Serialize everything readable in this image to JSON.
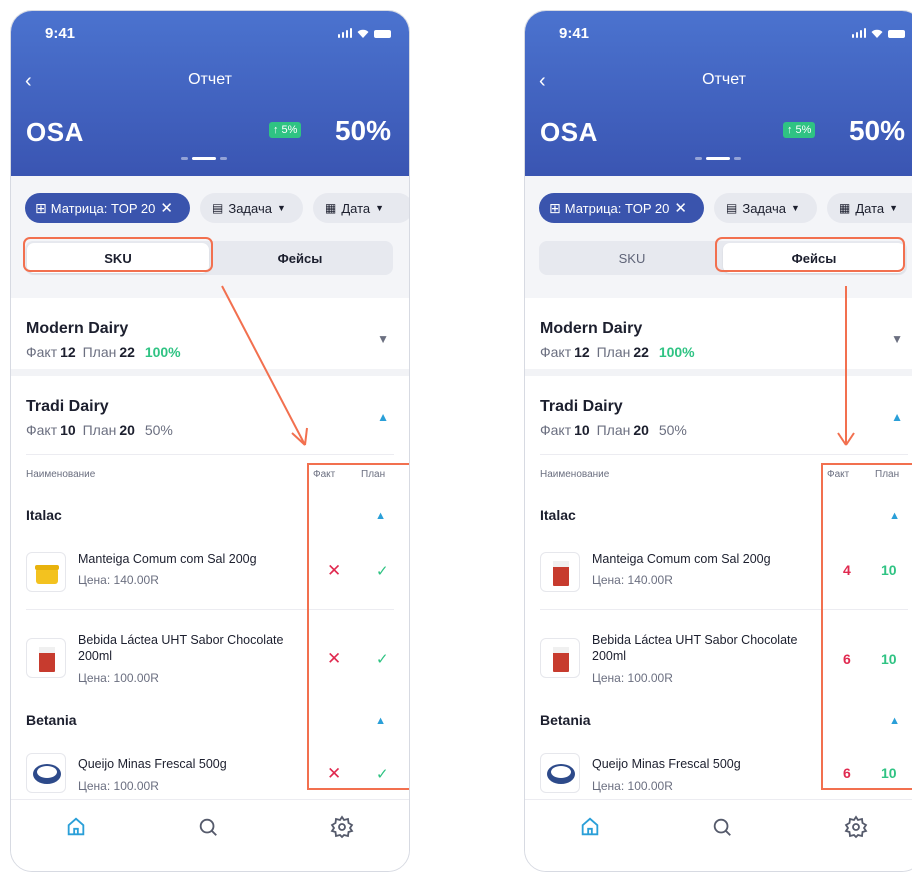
{
  "screens": [
    {
      "status": {
        "time": "9:41"
      },
      "header": {
        "title": "Отчет",
        "metric_name": "OSA",
        "delta": "↑ 5%",
        "value": "50%"
      },
      "filters": {
        "matrix": "Матрица: TOP 20",
        "task": "Задача",
        "date": "Дата"
      },
      "segments": {
        "sku": "SKU",
        "faces": "Фейсы",
        "active": "SKU"
      },
      "groups": [
        {
          "name": "Modern Dairy",
          "fact_label": "Факт",
          "fact": "12",
          "plan_label": "План",
          "plan": "22",
          "percent": "100%"
        },
        {
          "name": "Tradi Dairy",
          "fact_label": "Факт",
          "fact": "10",
          "plan_label": "План",
          "plan": "20",
          "percent": "50%"
        }
      ],
      "table": {
        "col_name": "Наименование",
        "col_fact": "Факт",
        "col_plan": "План"
      },
      "brands": [
        "Italac",
        "Betania"
      ],
      "products": [
        {
          "name": "Manteiga Comum com Sal 200g",
          "price": "Цена: 140.00R",
          "fact": "✕",
          "plan": "✓"
        },
        {
          "name": "Bebida Láctea UHT Sabor Chocolate 200ml",
          "price": "Цена: 100.00R",
          "fact": "✕",
          "plan": "✓"
        },
        {
          "name": "Queijo Minas Frescal 500g",
          "price": "Цена: 100.00R",
          "fact": "✕",
          "plan": "✓"
        }
      ]
    },
    {
      "status": {
        "time": "9:41"
      },
      "header": {
        "title": "Отчет",
        "metric_name": "OSA",
        "delta": "↑ 5%",
        "value": "50%"
      },
      "filters": {
        "matrix": "Матрица: TOP 20",
        "task": "Задача",
        "date": "Дата"
      },
      "segments": {
        "sku": "SKU",
        "faces": "Фейсы",
        "active": "Фейсы"
      },
      "groups": [
        {
          "name": "Modern Dairy",
          "fact_label": "Факт",
          "fact": "12",
          "plan_label": "План",
          "plan": "22",
          "percent": "100%"
        },
        {
          "name": "Tradi Dairy",
          "fact_label": "Факт",
          "fact": "10",
          "plan_label": "План",
          "plan": "20",
          "percent": "50%"
        }
      ],
      "table": {
        "col_name": "Наименование",
        "col_fact": "Факт",
        "col_plan": "План"
      },
      "brands": [
        "Italac",
        "Betania"
      ],
      "products": [
        {
          "name": "Manteiga Comum com Sal 200g",
          "price": "Цена: 140.00R",
          "fact": "4",
          "plan": "10"
        },
        {
          "name": "Bebida Láctea UHT Sabor Chocolate 200ml",
          "price": "Цена: 100.00R",
          "fact": "6",
          "plan": "10"
        },
        {
          "name": "Queijo Minas Frescal 500g",
          "price": "Цена: 100.00R",
          "fact": "6",
          "plan": "10"
        }
      ]
    }
  ],
  "colors": {
    "header_top": "#4b73cf",
    "header_bottom": "#3a55b2",
    "accent_chip": "#3a54ad",
    "highlight": "#f2704f",
    "success": "#2fc383",
    "danger": "#e0294f",
    "link": "#2a9fd8"
  },
  "icons": {
    "back": "chevron-left-icon",
    "grid": "grid-icon",
    "calendar": "calendar-icon",
    "tabs": [
      "home-icon",
      "search-icon",
      "settings-icon"
    ]
  }
}
